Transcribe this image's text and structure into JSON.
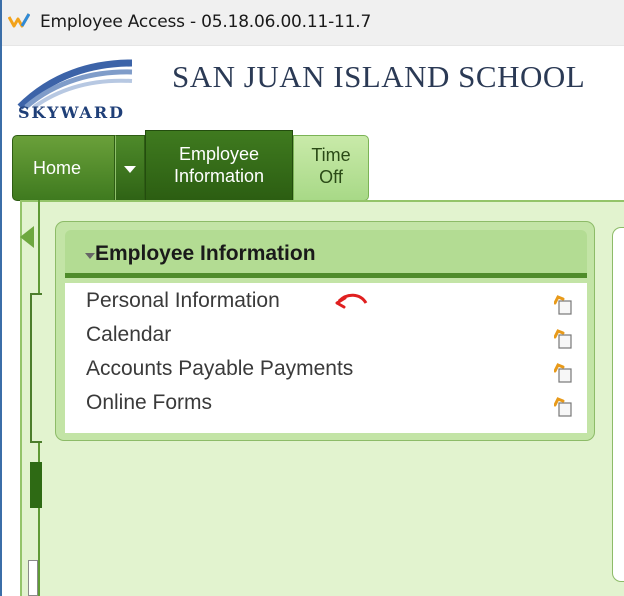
{
  "window": {
    "title": "Employee Access - 05.18.06.00.11-11.7"
  },
  "header": {
    "logo_text": "SKYWARD",
    "school_name": "SAN JUAN ISLAND SCHOOL"
  },
  "tabs": {
    "home": "Home",
    "employee_line1": "Employee",
    "employee_line2": "Information",
    "time_line1": "Time",
    "time_line2": "Off"
  },
  "module": {
    "title": "Employee Information",
    "items": [
      {
        "label": "Personal Information"
      },
      {
        "label": "Calendar"
      },
      {
        "label": "Accounts Payable Payments"
      },
      {
        "label": "Online Forms"
      }
    ]
  },
  "colors": {
    "accent_green": "#3f7a1f",
    "panel_green": "#c3e4a6",
    "annotation_red": "#e02020"
  }
}
